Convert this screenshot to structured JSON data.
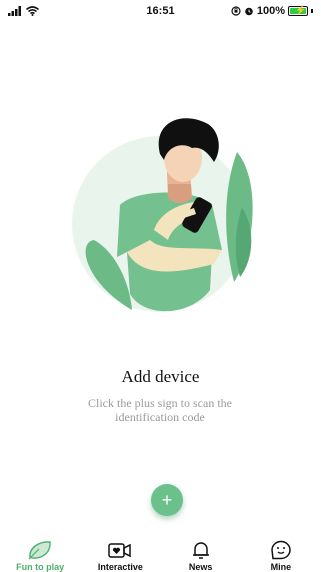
{
  "status_bar": {
    "time": "16:51",
    "battery_percent": "100%",
    "battery_level": 1.0,
    "icons": [
      "signal-icon",
      "wifi-icon",
      "orientation-lock-icon",
      "alarm-icon",
      "battery-icon"
    ]
  },
  "main": {
    "title": "Add device",
    "subtitle": "Click the plus sign to scan the identification code",
    "add_button_symbol": "+"
  },
  "tabs": [
    {
      "label": "Fun to play",
      "icon": "leaf-icon",
      "active": true
    },
    {
      "label": "Interactive",
      "icon": "video-heart-icon",
      "active": false
    },
    {
      "label": "News",
      "icon": "bell-icon",
      "active": false
    },
    {
      "label": "Mine",
      "icon": "face-icon",
      "active": false
    }
  ],
  "colors": {
    "accent": "#6cc08b",
    "active_tab": "#4caf6d",
    "subtitle": "#9a9a9a"
  }
}
